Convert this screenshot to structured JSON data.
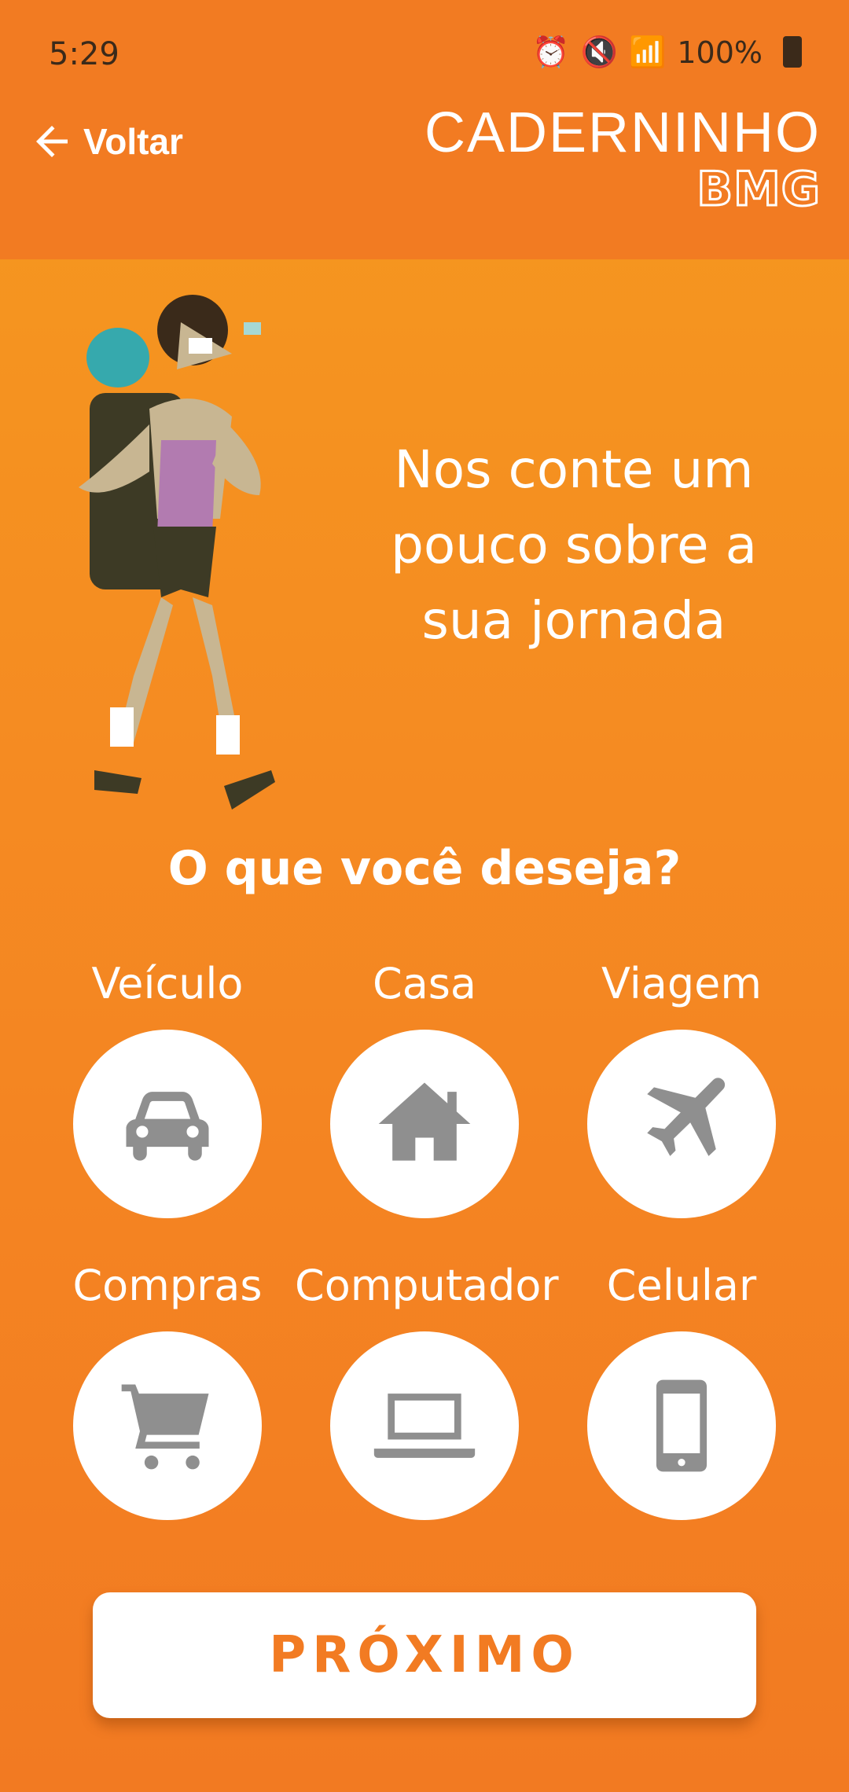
{
  "status_bar": {
    "time": "5:29",
    "battery": "100%"
  },
  "header": {
    "back_label": "Voltar",
    "logo_line1": "CADERNINHO",
    "logo_line2": "BMG"
  },
  "hero": {
    "headline": "Nos conte um pouco sobre a sua jornada"
  },
  "question": "O que você deseja?",
  "options": [
    {
      "label": "Veículo",
      "icon": "car-icon"
    },
    {
      "label": "Casa",
      "icon": "house-icon"
    },
    {
      "label": "Viagem",
      "icon": "airplane-icon"
    },
    {
      "label": "Compras",
      "icon": "shopping-cart-icon"
    },
    {
      "label": "Computador",
      "icon": "laptop-icon"
    },
    {
      "label": "Celular",
      "icon": "smartphone-icon"
    }
  ],
  "next_button": "PRÓXIMO",
  "colors": {
    "accent": "#f27b22",
    "icon_gray": "#8f8f8f"
  }
}
